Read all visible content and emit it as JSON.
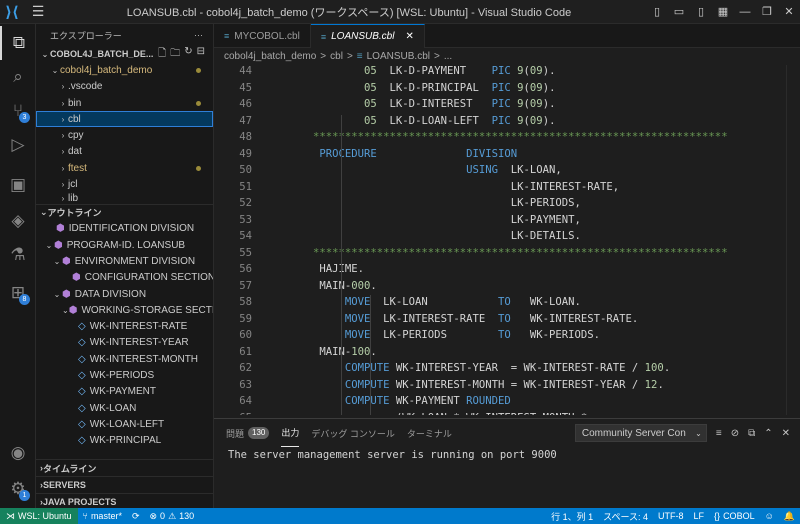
{
  "titlebar": {
    "title": "LOANSUB.cbl - cobol4j_batch_demo (ワークスペース) [WSL: Ubuntu] - Visual Studio Code",
    "logo_icon": "vscode-logo-icon",
    "menu_icon": "hamburger-icon"
  },
  "activity": {
    "scm_badge": "3",
    "extensions_badge": "8",
    "accounts_badge": "1"
  },
  "sidebar": {
    "title": "エクスプローラー",
    "workspace_root": "COBOL4J_BATCH_DE...",
    "folder": "cobol4j_batch_demo",
    "items": [
      {
        "label": ".vscode"
      },
      {
        "label": "bin"
      },
      {
        "label": "cbl"
      },
      {
        "label": "cpy"
      },
      {
        "label": "dat"
      },
      {
        "label": "ftest"
      },
      {
        "label": "jcl"
      },
      {
        "label": "lib"
      }
    ],
    "outline_title": "アウトライン",
    "outline": [
      {
        "label": "IDENTIFICATION DIVISION"
      },
      {
        "label": "PROGRAM-ID. LOANSUB"
      },
      {
        "label": "ENVIRONMENT DIVISION"
      },
      {
        "label": "CONFIGURATION SECTION"
      },
      {
        "label": "DATA DIVISION"
      },
      {
        "label": "WORKING-STORAGE SECTI..."
      },
      {
        "label": "WK-INTEREST-RATE"
      },
      {
        "label": "WK-INTEREST-YEAR"
      },
      {
        "label": "WK-INTEREST-MONTH"
      },
      {
        "label": "WK-PERIODS"
      },
      {
        "label": "WK-PAYMENT"
      },
      {
        "label": "WK-LOAN"
      },
      {
        "label": "WK-LOAN-LEFT"
      },
      {
        "label": "WK-PRINCIPAL"
      }
    ],
    "timeline_title": "タイムライン",
    "servers_title": "SERVERS",
    "java_projects_title": "JAVA PROJECTS"
  },
  "tabs": [
    {
      "label": "MYCOBOL.cbl"
    },
    {
      "label": "LOANSUB.cbl"
    }
  ],
  "breadcrumb": {
    "root": "cobol4j_batch_demo",
    "sep": ">",
    "folder": "cbl",
    "file": "LOANSUB.cbl",
    "tail": "..."
  },
  "editor": {
    "lines": [
      {
        "n": "44",
        "t": "        05  LK-D-PAYMENT    PIC 9(09)."
      },
      {
        "n": "45",
        "t": "        05  LK-D-PRINCIPAL  PIC 9(09)."
      },
      {
        "n": "46",
        "t": "        05  LK-D-INTEREST   PIC 9(09)."
      },
      {
        "n": "47",
        "t": "        05  LK-D-LOAN-LEFT  PIC 9(09)."
      },
      {
        "n": "48",
        "t": "*****************************************************************"
      },
      {
        "n": "49",
        "t": " PROCEDURE              DIVISION"
      },
      {
        "n": "50",
        "t": "                        USING  LK-LOAN,"
      },
      {
        "n": "51",
        "t": "                               LK-INTEREST-RATE,"
      },
      {
        "n": "52",
        "t": "                               LK-PERIODS,"
      },
      {
        "n": "53",
        "t": "                               LK-PAYMENT,"
      },
      {
        "n": "54",
        "t": "                               LK-DETAILS."
      },
      {
        "n": "55",
        "t": "*****************************************************************"
      },
      {
        "n": "56",
        "t": " HAJIME."
      },
      {
        "n": "57",
        "t": " MAIN-000."
      },
      {
        "n": "58",
        "t": "     MOVE  LK-LOAN           TO   WK-LOAN."
      },
      {
        "n": "59",
        "t": "     MOVE  LK-INTEREST-RATE  TO   WK-INTEREST-RATE."
      },
      {
        "n": "60",
        "t": "     MOVE  LK-PERIODS        TO   WK-PERIODS."
      },
      {
        "n": "61",
        "t": " MAIN-100."
      },
      {
        "n": "62",
        "t": "     COMPUTE WK-INTEREST-YEAR  = WK-INTEREST-RATE / 100."
      },
      {
        "n": "63",
        "t": "     COMPUTE WK-INTEREST-MONTH = WK-INTEREST-YEAR / 12."
      },
      {
        "n": "64",
        "t": "     COMPUTE WK-PAYMENT ROUNDED"
      },
      {
        "n": "65",
        "t": "             (WK-LOAN * WK-INTEREST-MONTH *"
      }
    ]
  },
  "panel": {
    "tab_problems": "問題",
    "problems_count": "130",
    "tab_output": "出力",
    "tab_debug": "デバッグ コンソール",
    "tab_terminal": "ターミナル",
    "channel": "Community Server Con",
    "output_text": "The server management server is running on port 9000"
  },
  "statusbar": {
    "remote": "WSL: Ubuntu",
    "branch": "master*",
    "errors": "0",
    "warnings": "130",
    "position": "行 1、列 1",
    "spaces": "スペース: 4",
    "encoding": "UTF-8",
    "eol": "LF",
    "language": "COBOL"
  },
  "colors": {
    "accent": "#007acc",
    "remote": "#16825d",
    "keyword": "#569cd6",
    "number": "#b5cea8",
    "comment": "#6a9955"
  }
}
